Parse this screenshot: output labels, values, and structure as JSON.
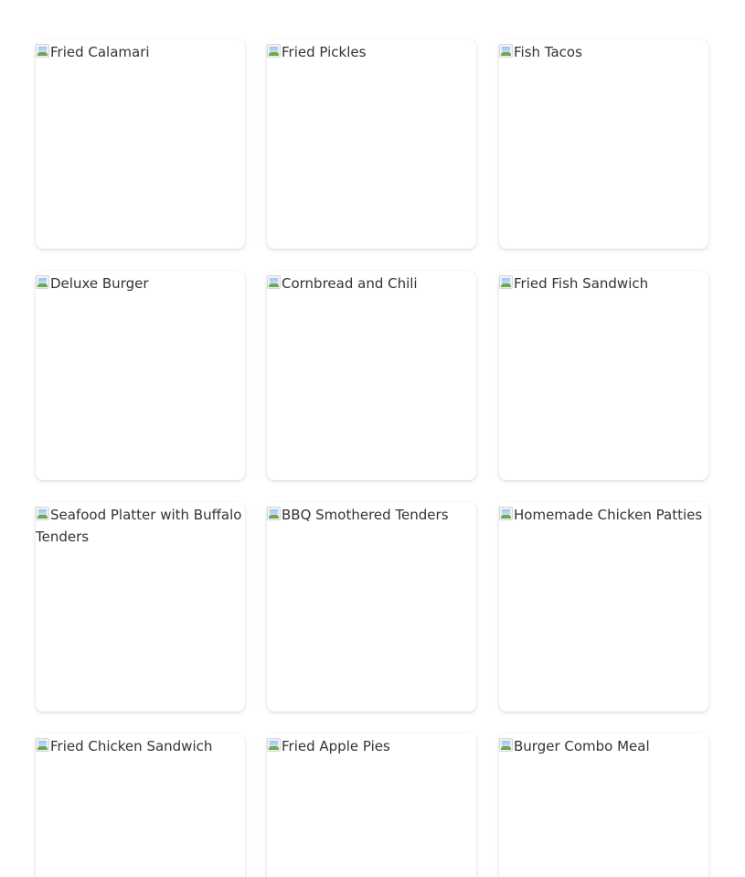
{
  "menu": {
    "items": [
      {
        "alt": "Fried Calamari"
      },
      {
        "alt": "Fried Pickles"
      },
      {
        "alt": "Fish Tacos"
      },
      {
        "alt": "Deluxe Burger"
      },
      {
        "alt": "Cornbread and Chili"
      },
      {
        "alt": "Fried Fish Sandwich"
      },
      {
        "alt": "Seafood Platter with Buffalo Tenders"
      },
      {
        "alt": "BBQ Smothered Tenders"
      },
      {
        "alt": "Homemade Chicken Patties"
      },
      {
        "alt": "Fried Chicken Sandwich"
      },
      {
        "alt": "Fried Apple Pies"
      },
      {
        "alt": "Burger Combo Meal"
      }
    ]
  },
  "icons": {
    "broken_image": "broken-image-icon"
  }
}
